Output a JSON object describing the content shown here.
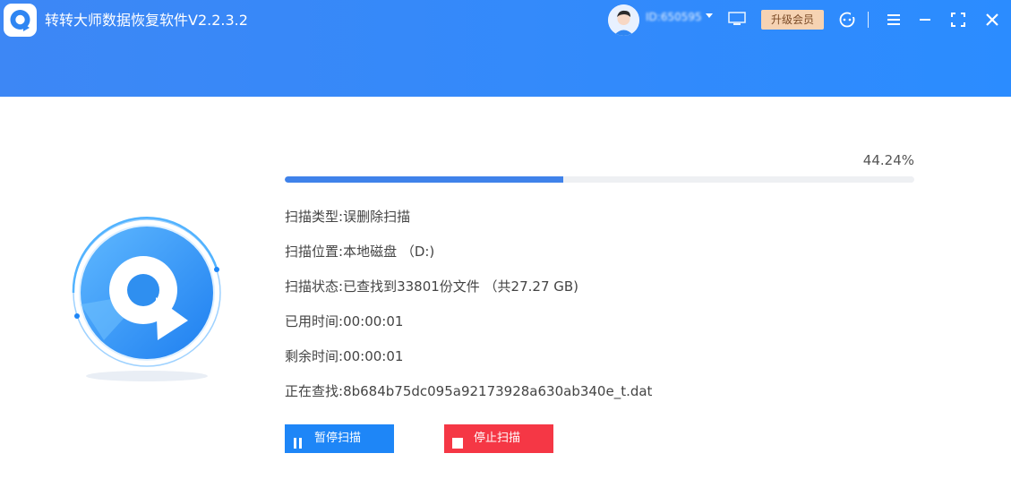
{
  "window": {
    "title": "转转大师数据恢复软件V2.2.3.2",
    "user_id": "ID:650595",
    "upgrade_label": "升级会员"
  },
  "icons": {
    "logo": "app-logo-icon",
    "avatar": "user-avatar",
    "dropdown": "chevron-down-icon",
    "monitor": "monitor-icon",
    "support": "customer-service-icon",
    "menu": "menu-icon",
    "minimize": "minimize-icon",
    "maximize": "maximize-icon",
    "close": "close-icon",
    "pause": "pause-icon",
    "stop": "stop-icon"
  },
  "colors": {
    "header_blue": "#2b8cff",
    "progress": "#3f82ea",
    "pause_button": "#1e86f7",
    "stop_button": "#f53745",
    "upgrade_button": "#f6d3b3"
  },
  "scan": {
    "progress_percent": 44.24,
    "progress_label": "44.24%",
    "rows": [
      {
        "label": "扫描类型:",
        "value": "误删除扫描"
      },
      {
        "label": "扫描位置:",
        "value": "本地磁盘 （D:)"
      },
      {
        "label": "扫描状态:",
        "value": "已查找到33801份文件 （共27.27 GB)"
      },
      {
        "label": "已用时间:",
        "value": "00:00:01"
      },
      {
        "label": "剩余时间:",
        "value": "00:00:01"
      },
      {
        "label": "正在查找:",
        "value": "8b684b75dc095a92173928a630ab340e_t.dat"
      }
    ]
  },
  "buttons": {
    "pause_label": "暂停扫描",
    "stop_label": "停止扫描"
  }
}
